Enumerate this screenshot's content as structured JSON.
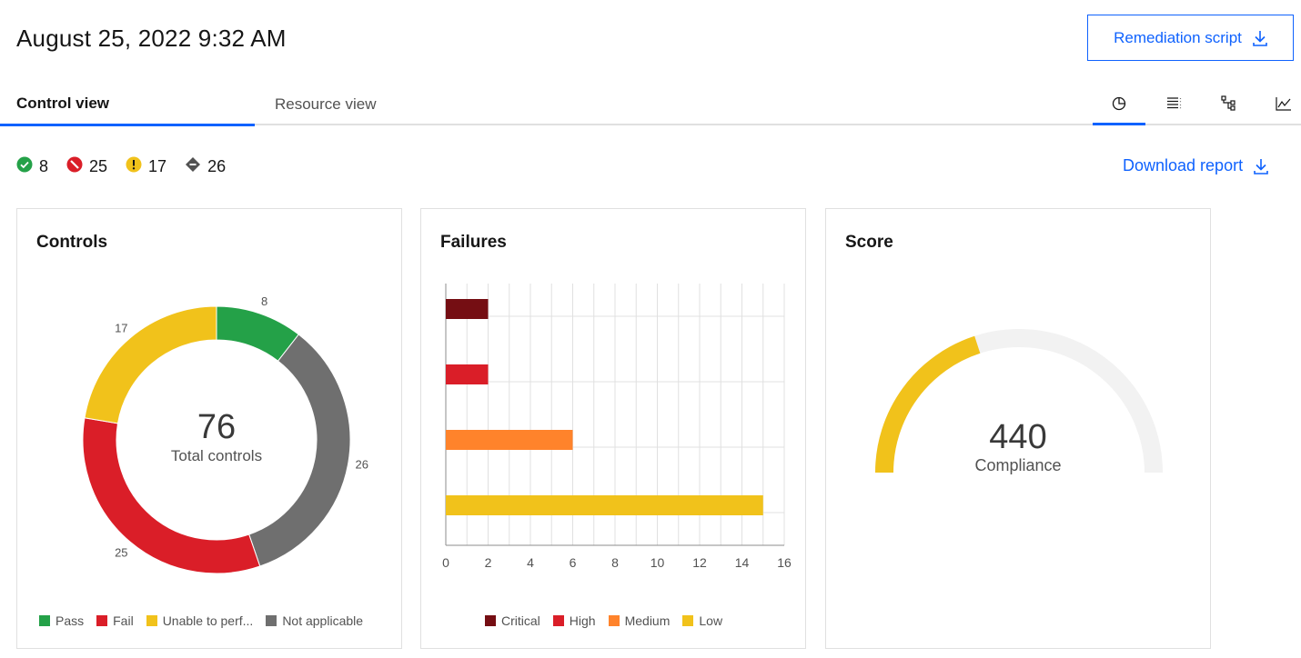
{
  "header": {
    "title": "August 25, 2022 9:32 AM",
    "remediation_label": "Remediation script"
  },
  "tabs": [
    {
      "label": "Control view",
      "active": true
    },
    {
      "label": "Resource view",
      "active": false
    }
  ],
  "view_icons": [
    "pie-chart-icon",
    "list-icon",
    "tree-icon",
    "line-chart-icon"
  ],
  "status_counts": {
    "pass": "8",
    "fail": "25",
    "unable": "17",
    "not_applicable": "26"
  },
  "download_label": "Download report",
  "colors": {
    "accent": "#0f62fe",
    "pass": "#24a148",
    "fail": "#da1e28",
    "unable": "#f1c21b",
    "not_applicable": "#6f6f6f",
    "critical": "#750e13",
    "high": "#da1e28",
    "medium": "#ff832b",
    "low": "#f1c21b"
  },
  "controls_card": {
    "title": "Controls",
    "total": "76",
    "total_label": "Total controls",
    "legend": [
      "Pass",
      "Fail",
      "Unable to perf...",
      "Not applicable"
    ]
  },
  "failures_card": {
    "title": "Failures",
    "legend": [
      "Critical",
      "High",
      "Medium",
      "Low"
    ]
  },
  "score_card": {
    "title": "Score",
    "value": "440",
    "label": "Compliance",
    "fill_fraction": 0.4
  },
  "chart_data": [
    {
      "type": "pie",
      "title": "Controls",
      "categories": [
        "Pass",
        "Not applicable",
        "Fail",
        "Unable to perf..."
      ],
      "values": [
        8,
        26,
        25,
        17
      ],
      "total": 76
    },
    {
      "type": "bar",
      "title": "Failures",
      "orientation": "horizontal",
      "categories": [
        "Critical",
        "High",
        "Medium",
        "Low"
      ],
      "values": [
        2,
        2,
        6,
        15
      ],
      "xlim": [
        0,
        16
      ],
      "xticks": [
        0,
        2,
        4,
        6,
        8,
        10,
        12,
        14,
        16
      ],
      "grid": true
    }
  ]
}
